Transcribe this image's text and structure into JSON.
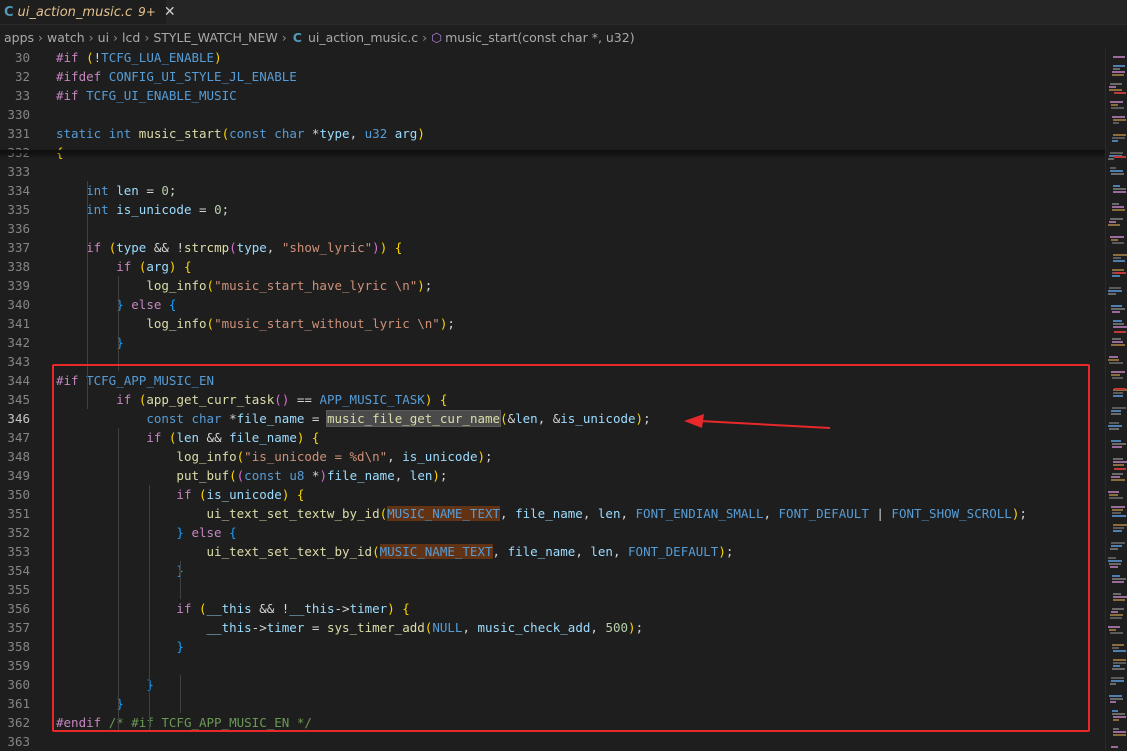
{
  "tab": {
    "icon": "C",
    "filename": "ui_action_music.c",
    "badge": "9+",
    "close": "✕"
  },
  "breadcrumb": {
    "parts": [
      "apps",
      "watch",
      "ui",
      "lcd",
      "STYLE_WATCH_NEW"
    ],
    "file_icon": "C",
    "file": "ui_action_music.c",
    "symbol": "music_start(const char *, u32)"
  },
  "lines": [
    {
      "no": "30",
      "text": "#if (!TCFG_LUA_ENABLE)"
    },
    {
      "no": "32",
      "text": "#ifdef CONFIG_UI_STYLE_JL_ENABLE"
    },
    {
      "no": "33",
      "text": "#if TCFG_UI_ENABLE_MUSIC"
    },
    {
      "no": "330",
      "text": ""
    },
    {
      "no": "331",
      "text": "static int music_start(const char *type, u32 arg)"
    },
    {
      "no": "332",
      "text": "{"
    },
    {
      "no": "333",
      "text": ""
    },
    {
      "no": "334",
      "text": "    int len = 0;"
    },
    {
      "no": "335",
      "text": "    int is_unicode = 0;"
    },
    {
      "no": "336",
      "text": ""
    },
    {
      "no": "337",
      "text": "    if (type && !strcmp(type, \"show_lyric\")) {"
    },
    {
      "no": "338",
      "text": "        if (arg) {"
    },
    {
      "no": "339",
      "text": "            log_info(\"music_start_have_lyric \\n\");"
    },
    {
      "no": "340",
      "text": "        } else {"
    },
    {
      "no": "341",
      "text": "            log_info(\"music_start_without_lyric \\n\");"
    },
    {
      "no": "342",
      "text": "        }"
    },
    {
      "no": "343",
      "text": ""
    },
    {
      "no": "344",
      "text": "#if TCFG_APP_MUSIC_EN"
    },
    {
      "no": "345",
      "text": "        if (app_get_curr_task() == APP_MUSIC_TASK) {"
    },
    {
      "no": "346",
      "text": "            const char *file_name = music_file_get_cur_name(&len, &is_unicode);"
    },
    {
      "no": "347",
      "text": "            if (len && file_name) {"
    },
    {
      "no": "348",
      "text": "                log_info(\"is_unicode = %d\\n\", is_unicode);"
    },
    {
      "no": "349",
      "text": "                put_buf((const u8 *)file_name, len);"
    },
    {
      "no": "350",
      "text": "                if (is_unicode) {"
    },
    {
      "no": "351",
      "text": "                    ui_text_set_textw_by_id(MUSIC_NAME_TEXT, file_name, len, FONT_ENDIAN_SMALL, FONT_DEFAULT | FONT_SHOW_SCROLL);"
    },
    {
      "no": "352",
      "text": "                } else {"
    },
    {
      "no": "353",
      "text": "                    ui_text_set_text_by_id(MUSIC_NAME_TEXT, file_name, len, FONT_DEFAULT);"
    },
    {
      "no": "354",
      "text": "                }"
    },
    {
      "no": "355",
      "text": ""
    },
    {
      "no": "356",
      "text": "                if (__this && !__this->timer) {"
    },
    {
      "no": "357",
      "text": "                    __this->timer = sys_timer_add(NULL, music_check_add, 500);"
    },
    {
      "no": "358",
      "text": "                }"
    },
    {
      "no": "359",
      "text": ""
    },
    {
      "no": "360",
      "text": "            }"
    },
    {
      "no": "361",
      "text": "        }"
    },
    {
      "no": "362",
      "text": "#endif /* #if TCFG_APP_MUSIC_EN */"
    },
    {
      "no": "363",
      "text": ""
    }
  ],
  "current_line": "346",
  "highlight_color": "#e8282b"
}
